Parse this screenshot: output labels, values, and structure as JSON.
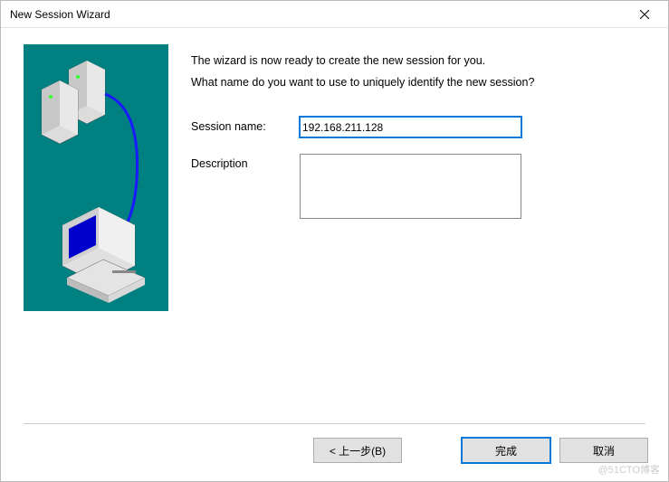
{
  "window": {
    "title": "New Session Wizard"
  },
  "wizard": {
    "heading": "The wizard is now ready to create the new session for you.",
    "subheading": "What name do you want to use to uniquely identify the new session?",
    "session_name_label": "Session name:",
    "session_name_value": "192.168.211.128",
    "description_label": "Description",
    "description_value": ""
  },
  "buttons": {
    "back": "< 上一步(B)",
    "finish": "完成",
    "cancel": "取消"
  },
  "watermark": "@51CTO博客"
}
